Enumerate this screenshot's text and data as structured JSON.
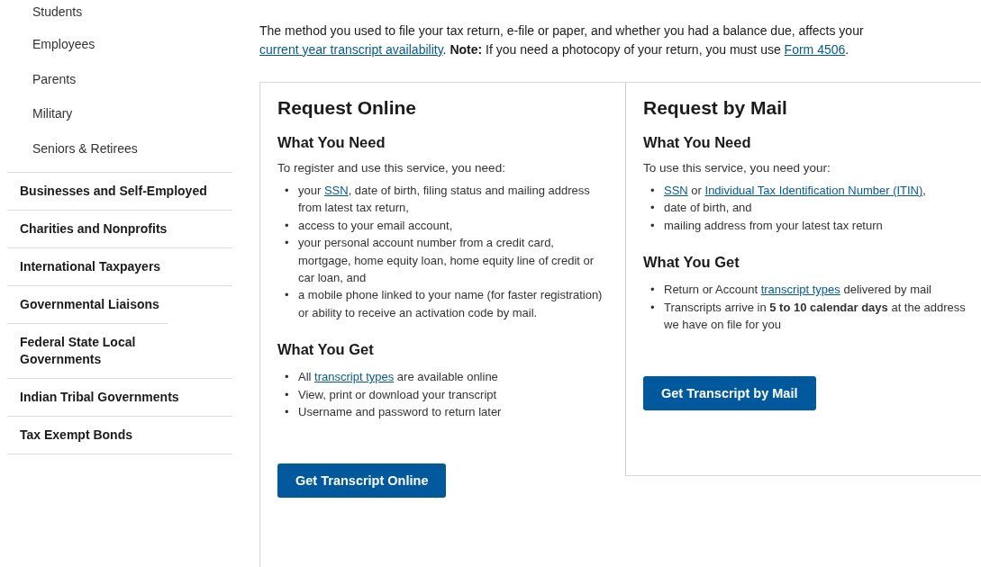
{
  "sidebar": {
    "sub_items": [
      "Students",
      "Employees",
      "Parents",
      "Military",
      "Seniors & Retirees"
    ],
    "items": [
      "Businesses and Self-Employed",
      "Charities and Nonprofits",
      "International Taxpayers",
      "Governmental Liaisons",
      "Federal State Local Governments",
      "Indian Tribal Governments",
      "Tax Exempt Bonds"
    ]
  },
  "intro": [
    {
      "kind": "text",
      "text": "The method you used to file your tax return, e-file or paper, and whether you had a balance due, affects your "
    },
    {
      "kind": "link",
      "text": "current year transcript availability"
    },
    {
      "kind": "text",
      "text": ". "
    },
    {
      "kind": "bold",
      "text": "Note:"
    },
    {
      "kind": "text",
      "text": " If you need a photocopy of your return, you must use "
    },
    {
      "kind": "link",
      "text": "Form 4506"
    },
    {
      "kind": "text",
      "text": "."
    }
  ],
  "cards": [
    {
      "title": "Request Online",
      "need_heading": "What You Need",
      "need_lead": "To register and use this service, you need:",
      "need_items": [
        {
          "marker": "•",
          "parts": [
            {
              "kind": "text",
              "text": "your "
            },
            {
              "kind": "link",
              "text": "SSN"
            },
            {
              "kind": "text",
              "text": ", date of birth, filing status and mailing address from latest tax return,"
            }
          ]
        },
        {
          "marker": "•",
          "parts": [
            {
              "kind": "text",
              "text": "access to your email account,"
            }
          ]
        },
        {
          "marker": "•",
          "parts": [
            {
              "kind": "text",
              "text": "your personal account number from a credit card, mortgage, home equity loan, home equity line of credit or car loan, and"
            }
          ]
        },
        {
          "marker": "•",
          "parts": [
            {
              "kind": "text",
              "text": "a mobile phone linked to your name (for faster registration) or ability to receive an activation code by mail."
            }
          ]
        }
      ],
      "get_heading": "What You Get",
      "get_items": [
        {
          "marker": "•",
          "parts": [
            {
              "kind": "text",
              "text": "All "
            },
            {
              "kind": "link",
              "text": "transcript types"
            },
            {
              "kind": "text",
              "text": " are available online"
            }
          ]
        },
        {
          "marker": "•",
          "parts": [
            {
              "kind": "text",
              "text": "View, print or download your transcript"
            }
          ]
        },
        {
          "marker": "•",
          "parts": [
            {
              "kind": "text",
              "text": "Username and password to return later"
            }
          ]
        }
      ],
      "button": "Get Transcript Online"
    },
    {
      "title": "Request by Mail",
      "need_heading": "What You Need",
      "need_lead": "To use this service, you need your:",
      "need_items": [
        {
          "marker": "•",
          "parts": [
            {
              "kind": "link",
              "text": "SSN"
            },
            {
              "kind": "text",
              "text": " or "
            },
            {
              "kind": "link",
              "text": "Individual Tax Identification Number (ITIN)"
            },
            {
              "kind": "text",
              "text": ","
            }
          ]
        },
        {
          "marker": "•",
          "parts": [
            {
              "kind": "text",
              "text": "date of birth, and"
            }
          ]
        },
        {
          "marker": "•",
          "parts": [
            {
              "kind": "text",
              "text": "mailing address from your latest tax return"
            }
          ]
        }
      ],
      "get_heading": "What You Get",
      "get_items": [
        {
          "marker": "•",
          "parts": [
            {
              "kind": "text",
              "text": "Return or Account "
            },
            {
              "kind": "link",
              "text": "transcript types"
            },
            {
              "kind": "text",
              "text": " delivered by mail"
            }
          ]
        },
        {
          "marker": "•",
          "parts": [
            {
              "kind": "text",
              "text": "Transcripts arrive in "
            },
            {
              "kind": "bold",
              "text": "5 to 10 calendar days"
            },
            {
              "kind": "text",
              "text": " at the address we have on file for you"
            }
          ]
        }
      ],
      "button": "Get Transcript by Mail"
    }
  ]
}
